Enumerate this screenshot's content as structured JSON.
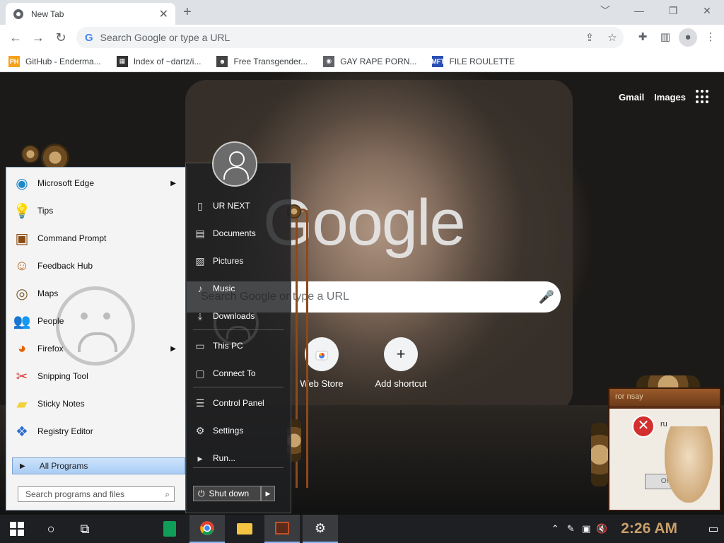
{
  "browser": {
    "tab_title": "New Tab",
    "tab_close": "✕",
    "newtab": "+",
    "window_controls": [
      "﹀",
      "—",
      "❐",
      "✕"
    ],
    "omnibox_placeholder": "Search Google or type a URL",
    "bookmarks": [
      {
        "label": "GitHub - Enderma...",
        "icon": "ph-badge",
        "badge": "PH",
        "color": "#f7a21b"
      },
      {
        "label": "Index of ~dartz/i...",
        "icon": "qr-icon",
        "badge": "▦",
        "color": "#333333"
      },
      {
        "label": "Free Transgender...",
        "icon": "mask-icon",
        "badge": "☻",
        "color": "#444444"
      },
      {
        "label": "GAY RAPE PORN...",
        "icon": "globe-icon",
        "badge": "◉",
        "color": "#5f6368"
      },
      {
        "label": "FILE ROULETTE",
        "icon": "mft-icon",
        "badge": "MFT",
        "color": "#2a4fb5"
      }
    ]
  },
  "ntp": {
    "links": [
      "Gmail",
      "Images"
    ],
    "logo": "Google",
    "search_placeholder": "Search Google or type a URL",
    "shortcuts": [
      {
        "label": "Web Store",
        "icon": "chrome-store-icon"
      },
      {
        "label": "Add shortcut",
        "icon": "plus-icon",
        "glyph": "+"
      }
    ]
  },
  "startmenu": {
    "programs": [
      {
        "label": "Microsoft Edge",
        "icon": "edge-icon",
        "glyph": "◉",
        "color": "#1e88c8",
        "submenu": true
      },
      {
        "label": "Tips",
        "icon": "bulb-icon",
        "glyph": "💡",
        "color": "#f4b400",
        "submenu": false
      },
      {
        "label": "Command Prompt",
        "icon": "cmd-icon",
        "glyph": "▣",
        "color": "#8a4b10",
        "submenu": false
      },
      {
        "label": "Feedback Hub",
        "icon": "feedback-icon",
        "glyph": "☺",
        "color": "#b5651d",
        "submenu": false
      },
      {
        "label": "Maps",
        "icon": "maps-icon",
        "glyph": "◎",
        "color": "#7a5a2a",
        "submenu": false
      },
      {
        "label": "People",
        "icon": "people-icon",
        "glyph": "👥",
        "color": "#8a5a2a",
        "submenu": false
      },
      {
        "label": "Firefox",
        "icon": "firefox-icon",
        "glyph": "◕",
        "color": "#e66000",
        "submenu": true
      },
      {
        "label": "Snipping Tool",
        "icon": "scissors-icon",
        "glyph": "✂",
        "color": "#d23f3f",
        "submenu": false
      },
      {
        "label": "Sticky Notes",
        "icon": "sticky-icon",
        "glyph": "▰",
        "color": "#f2d13a",
        "submenu": false
      },
      {
        "label": "Registry Editor",
        "icon": "registry-icon",
        "glyph": "❖",
        "color": "#2c6fd1",
        "submenu": false
      }
    ],
    "all_programs": "All Programs",
    "search_placeholder": "Search programs and files",
    "links": [
      {
        "label": "UR NEXT",
        "icon": "user-doc-icon",
        "glyph": "▯"
      },
      {
        "label": "Documents",
        "icon": "documents-icon",
        "glyph": "▤"
      },
      {
        "label": "Pictures",
        "icon": "pictures-icon",
        "glyph": "▨"
      },
      {
        "label": "Music",
        "icon": "music-icon",
        "glyph": "♪"
      },
      {
        "label": "Downloads",
        "icon": "download-icon",
        "glyph": "⤓"
      },
      {
        "label": "This PC",
        "icon": "pc-icon",
        "glyph": "▭"
      },
      {
        "label": "Connect To",
        "icon": "connect-icon",
        "glyph": "▢"
      },
      {
        "label": "Control Panel",
        "icon": "control-panel-icon",
        "glyph": "☰"
      },
      {
        "label": "Settings",
        "icon": "settings-icon",
        "glyph": "⚙"
      },
      {
        "label": "Run...",
        "icon": "run-icon",
        "glyph": "▸"
      }
    ],
    "shutdown": "Shut down"
  },
  "dialog": {
    "title": "ror nsay",
    "message": "ru",
    "button": "OK"
  },
  "taskbar": {
    "clock": "2:26 AM"
  }
}
